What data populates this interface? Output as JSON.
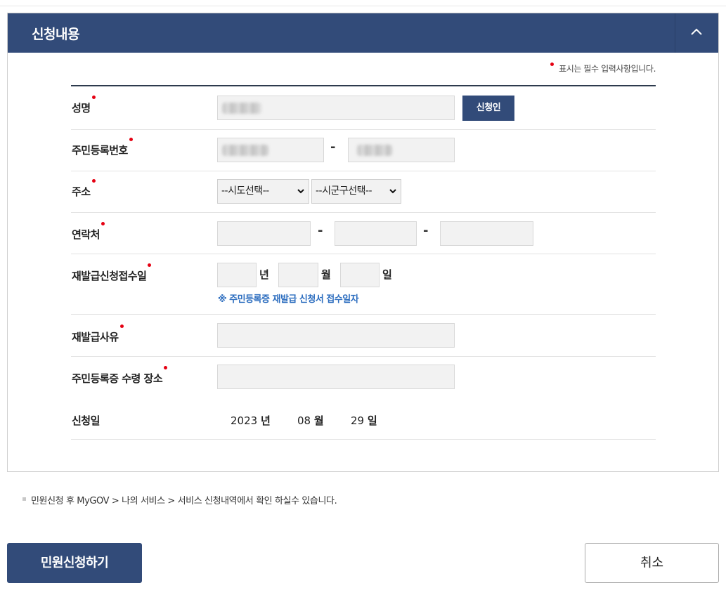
{
  "panel": {
    "title": "신청내용",
    "collapse_icon": "chevron-up-icon"
  },
  "required_note": "표시는 필수 입력사항입니다.",
  "colors": {
    "header_bg": "#324b79",
    "required_dot": "#e50012",
    "hint_text": "#2c6dbf"
  },
  "form": {
    "name": {
      "label": "성명",
      "value": "",
      "lookup_button": "신청인"
    },
    "resident_number": {
      "label": "주민등록번호",
      "separator": "-"
    },
    "address": {
      "label": "주소",
      "sido_select": "--시도선택--",
      "sigungu_select": "--시군구선택--"
    },
    "contact": {
      "label": "연락처",
      "separator1": "-",
      "separator2": "-"
    },
    "reissue_date": {
      "label": "재발급신청접수일",
      "year_unit": "년",
      "month_unit": "월",
      "day_unit": "일",
      "hint": "※ 주민등록증 재발급 신청서 접수일자"
    },
    "reissue_reason": {
      "label": "재발급사유"
    },
    "pickup_place": {
      "label": "주민등록증 수령 장소"
    },
    "application_date": {
      "label": "신청일",
      "year": "2023",
      "year_unit": "년",
      "month": "08",
      "month_unit": "월",
      "day": "29",
      "day_unit": "일"
    }
  },
  "footnote": "민원신청 후 MyGOV > 나의 서비스 > 서비스 신청내역에서 확인 하실수 있습니다.",
  "actions": {
    "submit": "민원신청하기",
    "cancel": "취소"
  }
}
